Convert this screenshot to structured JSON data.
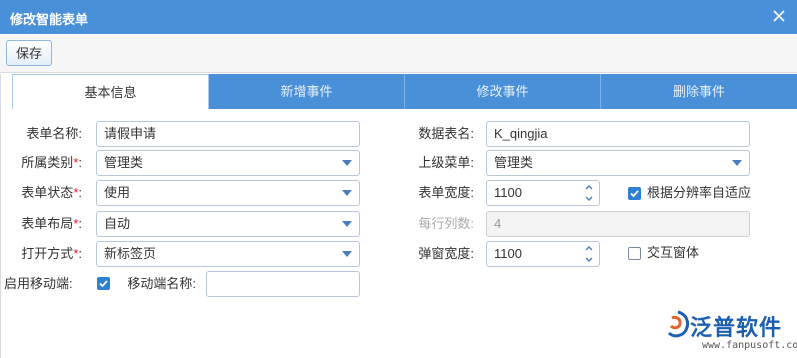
{
  "window": {
    "title": "修改智能表单"
  },
  "toolbar": {
    "save_label": "保存"
  },
  "tabs": [
    {
      "label": "基本信息"
    },
    {
      "label": "新增事件"
    },
    {
      "label": "修改事件"
    },
    {
      "label": "删除事件"
    }
  ],
  "form": {
    "form_name": {
      "label": "表单名称:",
      "value": "请假申请"
    },
    "category": {
      "label": "所属类别",
      "value": "管理类"
    },
    "status": {
      "label": "表单状态",
      "value": "使用"
    },
    "layout": {
      "label": "表单布局",
      "value": "自动"
    },
    "open_mode": {
      "label": "打开方式",
      "value": "新标签页"
    },
    "mobile": {
      "label": "启用移动端:",
      "checked": true
    },
    "mobile_name": {
      "label": "移动端名称:",
      "value": ""
    },
    "table_name": {
      "label": "数据表名:",
      "value": "K_qingjia"
    },
    "parent_menu": {
      "label": "上级菜单:",
      "value": "管理类"
    },
    "form_width": {
      "label": "表单宽度:",
      "value": "1100"
    },
    "auto_fit": {
      "label": "根据分辨率自适应",
      "checked": true
    },
    "columns_per_row": {
      "label": "每行列数:",
      "value": "4"
    },
    "popup_width": {
      "label": "弹窗宽度:",
      "value": "1100"
    },
    "interactive_window": {
      "label": "交互窗体",
      "checked": false
    },
    "required_mark": "*",
    "colon": ":"
  },
  "logo": {
    "brand": "泛普软件",
    "url": "www.fanpusoft.com"
  },
  "colors": {
    "accent": "#4a90d9",
    "checkbox": "#2f80d1",
    "required": "#e02020"
  }
}
